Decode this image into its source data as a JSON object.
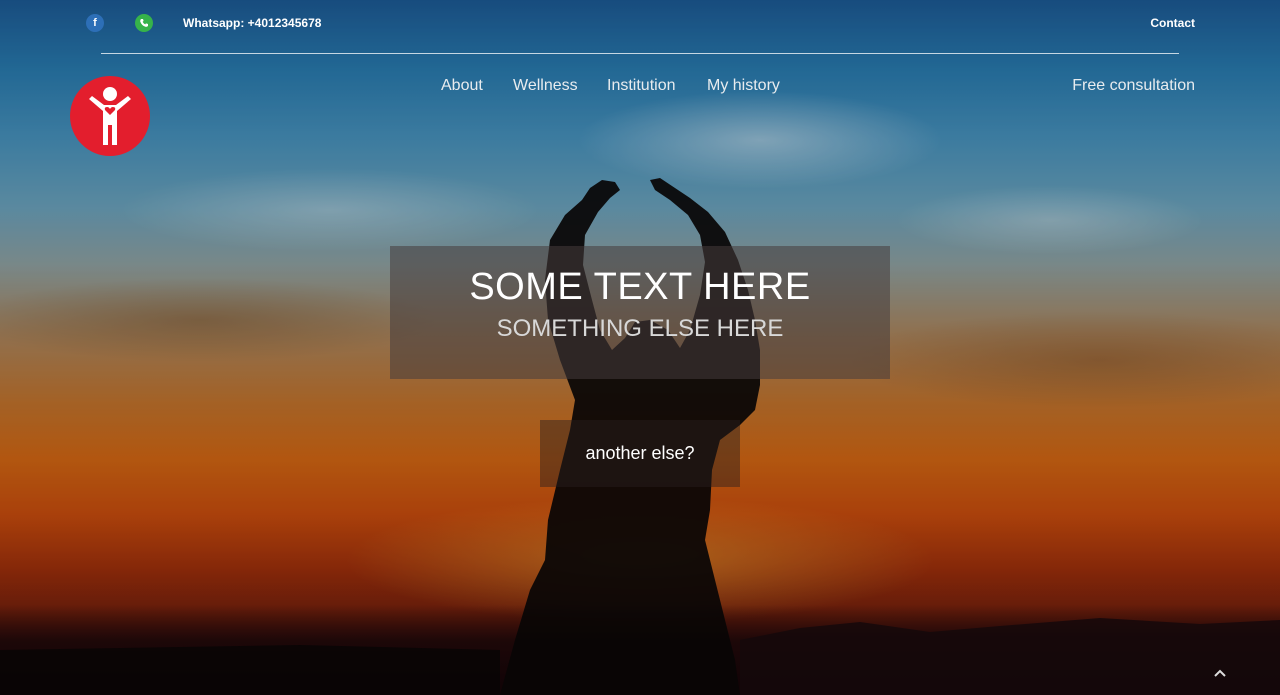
{
  "topbar": {
    "facebook_icon": "f",
    "whatsapp_text": "Whatsapp: +4012345678",
    "contact_label": "Contact"
  },
  "nav": {
    "items": [
      {
        "label": "About"
      },
      {
        "label": "Wellness"
      },
      {
        "label": "Institution"
      },
      {
        "label": "My history"
      }
    ],
    "cta_label": "Free consultation"
  },
  "hero": {
    "title": "SOME TEXT HERE",
    "subtitle": "SOMETHING ELSE HERE",
    "button_label": "another else?"
  },
  "scroll_top_icon": "chevron-up-icon",
  "colors": {
    "logo_red": "#e31e2d",
    "facebook_blue": "#2d6fb7",
    "whatsapp_green": "#36b34a"
  }
}
